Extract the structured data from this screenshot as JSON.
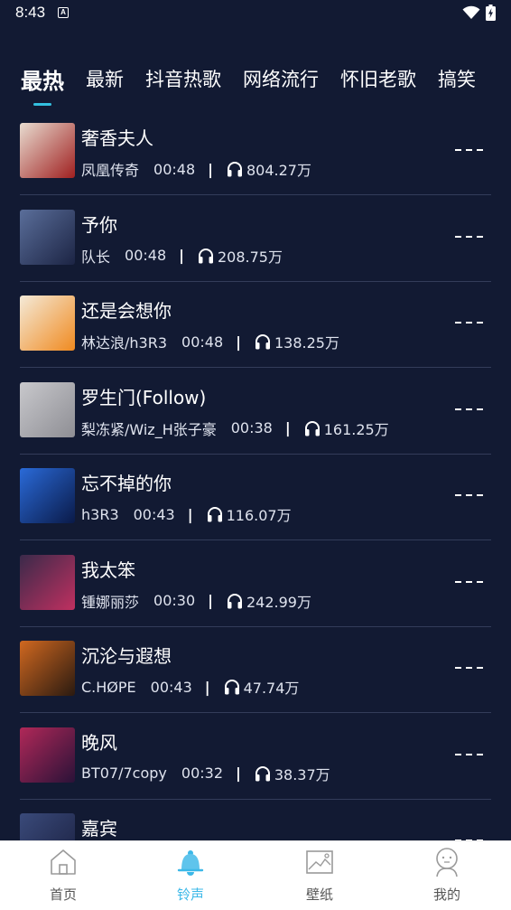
{
  "status_bar": {
    "time": "8:43",
    "notification_letter": "A"
  },
  "tabs": [
    {
      "label": "最热",
      "active": true
    },
    {
      "label": "最新"
    },
    {
      "label": "抖音热歌"
    },
    {
      "label": "网络流行"
    },
    {
      "label": "怀旧老歌"
    },
    {
      "label": "搞笑"
    }
  ],
  "songs": [
    {
      "title": "奢香夫人",
      "artist": "凤凰传奇",
      "duration": "00:48",
      "separator": "|",
      "plays": "804.27万",
      "cover_colors": [
        "#e8dcd0",
        "#a02020"
      ]
    },
    {
      "title": "予你",
      "artist": "队长",
      "duration": "00:48",
      "separator": "|",
      "plays": "208.75万",
      "cover_colors": [
        "#5a6e9a",
        "#1c2444"
      ]
    },
    {
      "title": "还是会想你",
      "artist": "林达浪/h3R3",
      "duration": "00:48",
      "separator": "|",
      "plays": "138.25万",
      "cover_colors": [
        "#f4ead8",
        "#f08a20"
      ]
    },
    {
      "title": "罗生门(Follow)",
      "artist": "梨冻紧/Wiz_H张子豪",
      "duration": "00:38",
      "separator": "|",
      "plays": "161.25万",
      "cover_colors": [
        "#c8c8cc",
        "#8e8e94"
      ]
    },
    {
      "title": "忘不掉的你",
      "artist": "h3R3",
      "duration": "00:43",
      "separator": "|",
      "plays": "116.07万",
      "cover_colors": [
        "#2a6ad8",
        "#0a1a48"
      ]
    },
    {
      "title": "我太笨",
      "artist": "锺娜丽莎",
      "duration": "00:30",
      "separator": "|",
      "plays": "242.99万",
      "cover_colors": [
        "#3a2a4a",
        "#c03060"
      ]
    },
    {
      "title": "沉沦与遐想",
      "artist": "C.HØPE",
      "duration": "00:43",
      "separator": "|",
      "plays": "47.74万",
      "cover_colors": [
        "#d06820",
        "#2a1a10"
      ]
    },
    {
      "title": "晚风",
      "artist": "BT07/7copy",
      "duration": "00:32",
      "separator": "|",
      "plays": "38.37万",
      "cover_colors": [
        "#b02858",
        "#2a1238"
      ]
    },
    {
      "title": "嘉宾",
      "artist": "",
      "duration": "",
      "separator": "",
      "plays": "",
      "cover_colors": [
        "#3a4a7a",
        "#1a2040"
      ]
    }
  ],
  "bottom_nav": [
    {
      "label": "首页",
      "icon": "home-icon"
    },
    {
      "label": "铃声",
      "icon": "bell-icon",
      "active": true
    },
    {
      "label": "壁纸",
      "icon": "wallpaper-icon"
    },
    {
      "label": "我的",
      "icon": "profile-icon"
    }
  ],
  "colors": {
    "background": "#121a33",
    "accent": "#3cb8e8",
    "divider": "#333c5a"
  }
}
